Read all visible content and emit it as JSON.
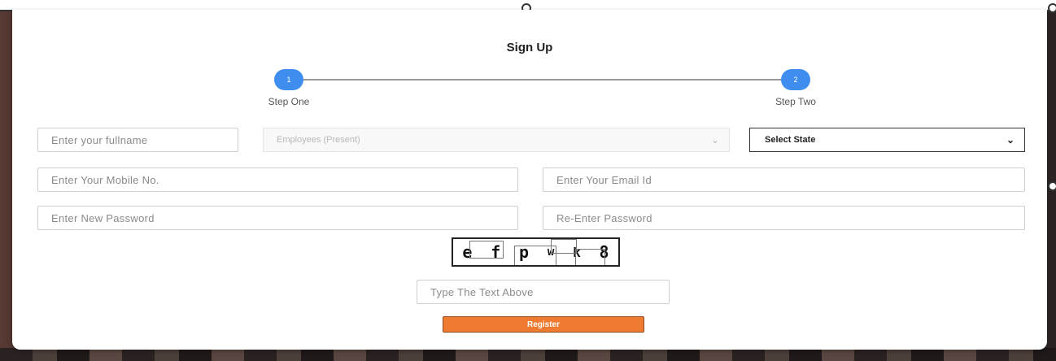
{
  "form": {
    "title": "Sign Up",
    "steps": [
      {
        "number": "1",
        "label": "Step One"
      },
      {
        "number": "2",
        "label": "Step Two"
      }
    ],
    "fields": {
      "fullname_placeholder": "Enter your fullname",
      "employee_select_value": "Employees (Present)",
      "state_select_value": "Select State",
      "mobile_placeholder": "Enter Your Mobile No.",
      "email_placeholder": "Enter Your Email Id",
      "password_placeholder": "Enter New Password",
      "reenter_password_placeholder": "Re-Enter Password",
      "captcha_input_placeholder": "Type The Text Above"
    },
    "captcha_chars": [
      "e",
      "f",
      "p",
      "w",
      "k",
      "8"
    ],
    "register_label": "Register",
    "colors": {
      "step_circle": "#3f8eef",
      "register_button": "#ee7b2f"
    },
    "icons": {
      "select_arrow": "chevron-down-icon"
    }
  }
}
